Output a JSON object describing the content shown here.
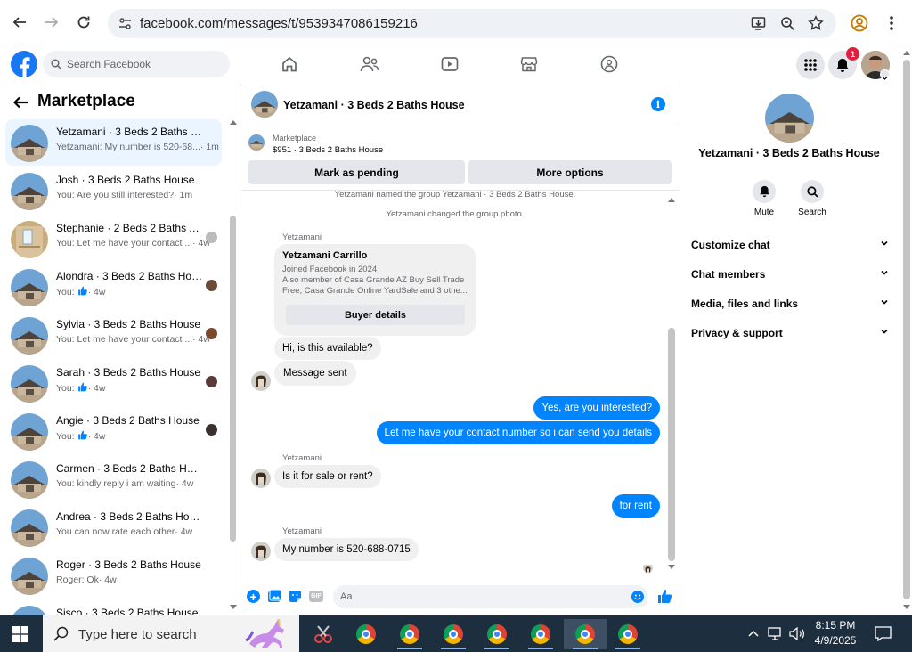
{
  "browser": {
    "url": "facebook.com/messages/t/9539347086159216"
  },
  "fb": {
    "search_placeholder": "Search Facebook",
    "notification_count": "1"
  },
  "sidebar": {
    "title": "Marketplace",
    "conversations": [
      {
        "name": "Yetzamani · 3 Beds 2 Baths House",
        "preview": "Yetzamani: My number is 520-68...",
        "time": "· 1m",
        "active": true
      },
      {
        "name": "Josh · 3 Beds 2 Baths House",
        "preview": "You: Are you still interested?",
        "time": "· 1m"
      },
      {
        "name": "Stephanie · 2 Beds 2 Baths A...",
        "preview": "You: Let me have your contact ...",
        "time": "· 4w"
      },
      {
        "name": "Alondra · 3 Beds 2 Baths Hou...",
        "preview": "You:",
        "time": "· 4w"
      },
      {
        "name": "Sylvia · 3 Beds 2 Baths House",
        "preview": "You: Let me have your contact ...",
        "time": "· 4w"
      },
      {
        "name": "Sarah · 3 Beds 2 Baths House",
        "preview": "You:",
        "time": "· 4w"
      },
      {
        "name": "Angie · 3 Beds 2 Baths House",
        "preview": "You:",
        "time": "· 4w"
      },
      {
        "name": "Carmen · 3 Beds 2 Baths House",
        "preview": "You: kindly reply i am waiting",
        "time": "· 4w"
      },
      {
        "name": "Andrea · 3 Beds 2 Baths House",
        "preview": "You can now rate each other",
        "time": "· 4w"
      },
      {
        "name": "Roger · 3 Beds 2 Baths House",
        "preview": "Roger: Ok",
        "time": "· 4w"
      },
      {
        "name": "Sisco · 3 Beds 2 Baths House",
        "preview": "",
        "time": ""
      }
    ]
  },
  "chat": {
    "title": "Yetzamani · 3 Beds 2 Baths House",
    "marketplace_label": "Marketplace",
    "listing": "$951 · 3 Beds 2 Baths House",
    "mark_pending": "Mark as pending",
    "more_options": "More options",
    "sys_1": "Yetzamani named the group Yetzamani · 3 Beds 2 Baths House.",
    "sys_2": "Yetzamani changed the group photo.",
    "sender": "Yetzamani",
    "card_name": "Yetzamani Carrillo",
    "card_joined": "Joined Facebook in 2024",
    "card_member_1": "Also member of Casa Grande AZ Buy Sell Trade",
    "card_member_2": "Free, Casa Grande Online YardSale and 3 othe...",
    "buyer_details": "Buyer details",
    "msg_available": "Hi, is this available?",
    "msg_sent": "Message sent",
    "msg_interested": "Yes, are you interested?",
    "msg_contact": "Let me have your contact number so i can send you details",
    "msg_sale_rent": "Is it for sale or rent?",
    "msg_for_rent": "for rent",
    "msg_number": "My number is 520-688-0715",
    "composer_placeholder": "Aa"
  },
  "info": {
    "title": "Yetzamani · 3 Beds 2 Baths House",
    "mute": "Mute",
    "search": "Search",
    "rows": [
      "Customize chat",
      "Chat members",
      "Media, files and links",
      "Privacy & support"
    ]
  },
  "taskbar": {
    "search_placeholder": "Type here to search",
    "time": "8:15 PM",
    "date": "4/9/2025"
  },
  "colors": {
    "accent": "#0084ff",
    "fb_blue": "#1877f2"
  }
}
